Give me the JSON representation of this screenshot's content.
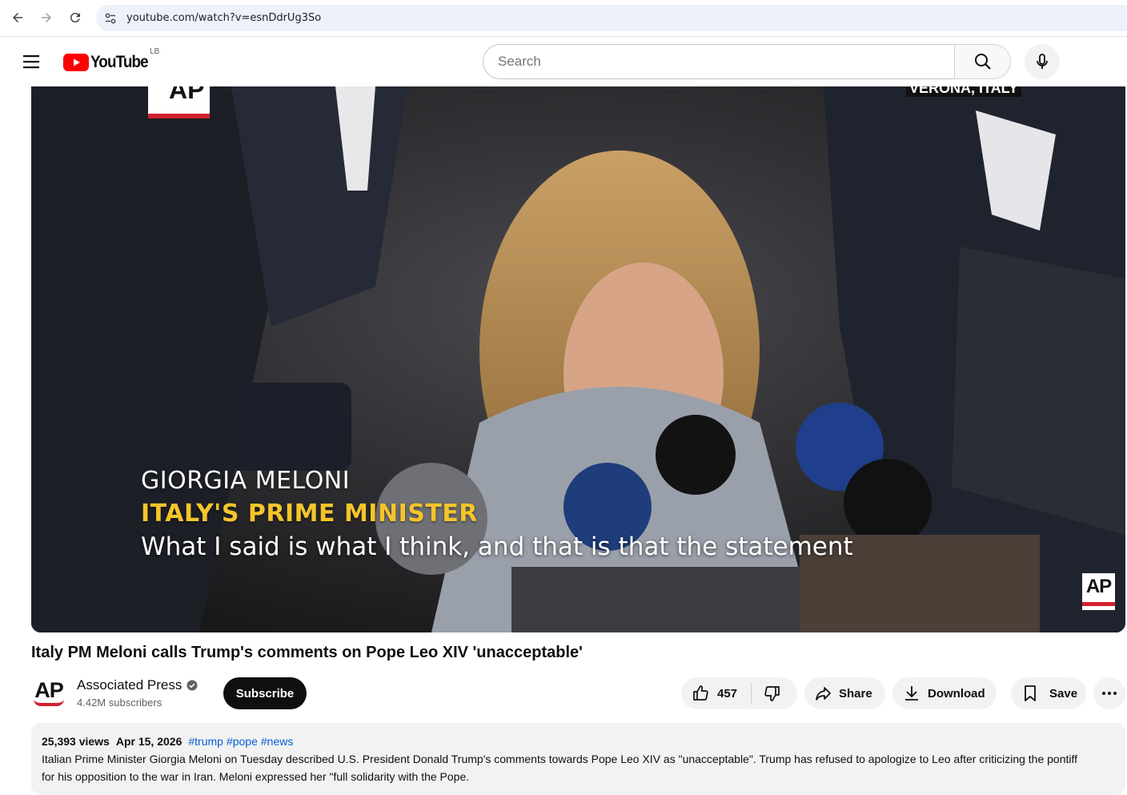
{
  "browser": {
    "url": "youtube.com/watch?v=esnDdrUg3So"
  },
  "header": {
    "logo_text": "YouTube",
    "region": "LB",
    "search_placeholder": "Search"
  },
  "player": {
    "location_banner": "VERONA, ITALY",
    "ap_top_text": "AP",
    "caption_name": "GIORGIA MELONI",
    "caption_role": "ITALY'S PRIME MINISTER",
    "caption_quote": "What I said is what I think, and that is that the statement",
    "watermark": "AP"
  },
  "video": {
    "title": "Italy PM Meloni calls Trump's comments on Pope Leo XIV 'unacceptable'"
  },
  "channel": {
    "avatar_text": "AP",
    "name": "Associated Press",
    "subscribers": "4.42M subscribers",
    "subscribe_label": "Subscribe"
  },
  "actions": {
    "like_count": "457",
    "share_label": "Share",
    "download_label": "Download",
    "save_label": "Save"
  },
  "description": {
    "views": "25,393 views",
    "date": "Apr 15, 2026",
    "tags": [
      "#trump",
      "#pope",
      "#news"
    ],
    "text": "Italian Prime Minister Giorgia Meloni on Tuesday described U.S. President Donald Trump's comments towards Pope Leo XIV as \"unacceptable\". Trump has refused to apologize to Leo after criticizing the pontiff for his opposition to the war in Iran. Meloni expressed her \"full solidarity with  the Pope."
  },
  "colors": {
    "brand_red": "#ff0000",
    "ap_red": "#d3202e",
    "caption_yellow": "#f4c42b",
    "link_blue": "#065fd4"
  }
}
